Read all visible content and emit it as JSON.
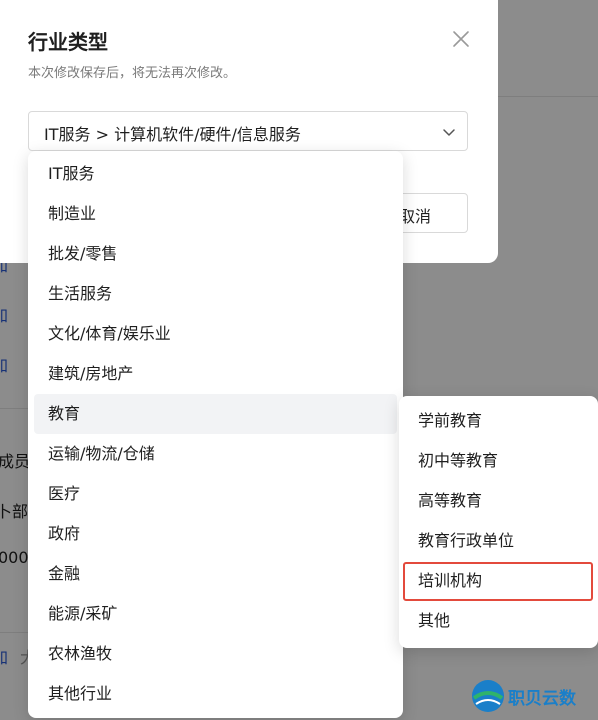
{
  "modal": {
    "title": "行业类型",
    "subtitle": "本次修改保存后，将无法再次修改。",
    "select_value": "IT服务 > 计算机软件/硬件/信息服务",
    "cancel_label": "取消"
  },
  "dropdown": {
    "items": [
      "IT服务",
      "制造业",
      "批发/零售",
      "生活服务",
      "文化/体育/娱乐业",
      "建筑/房地产",
      "教育",
      "运输/物流/仓储",
      "医疗",
      "政府",
      "金融",
      "能源/采矿",
      "农林渔牧",
      "其他行业"
    ],
    "active_index": 6
  },
  "subdropdown": {
    "items": [
      "学前教育",
      "初中等教育",
      "高等教育",
      "教育行政单位",
      "培训机构",
      "其他"
    ],
    "highlighted_index": 4
  },
  "background": {
    "frag_1": "加",
    "frag_2": "加",
    "frag_3": "加",
    "frag_4": "成员",
    "frag_5": "卜部门",
    "frag_6": "000",
    "frag_7": "加",
    "frag_8": "大"
  },
  "watermark": {
    "text": "职贝云数"
  },
  "colors": {
    "highlight": "#e34a3c",
    "link": "#2b5bd7",
    "watermark": "#1a7fc9"
  }
}
